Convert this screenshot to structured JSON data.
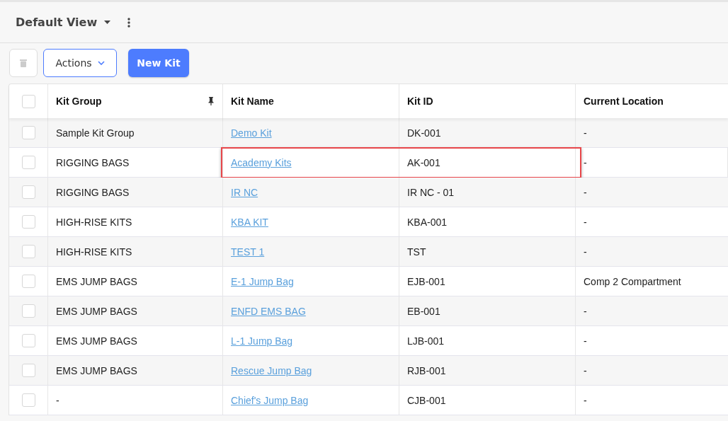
{
  "view": {
    "title": "Default View"
  },
  "toolbar": {
    "actions_label": "Actions",
    "new_label": "New Kit"
  },
  "table": {
    "all_checked": false,
    "columns": [
      {
        "label": "Kit Group",
        "pinned": true
      },
      {
        "label": "Kit Name",
        "pinned": false
      },
      {
        "label": "Kit ID",
        "pinned": false
      },
      {
        "label": "Current Location",
        "pinned": false
      }
    ],
    "rows": [
      {
        "checked": false,
        "highlighted": false,
        "group": "Sample Kit Group",
        "name": "Demo Kit",
        "id": "DK-001",
        "location": "-"
      },
      {
        "checked": false,
        "highlighted": true,
        "group": "RIGGING BAGS",
        "name": "Academy Kits",
        "id": "AK-001",
        "location": "-"
      },
      {
        "checked": false,
        "highlighted": false,
        "group": "RIGGING BAGS",
        "name": "IR NC",
        "id": "IR NC - 01",
        "location": "-"
      },
      {
        "checked": false,
        "highlighted": false,
        "group": "HIGH-RISE KITS",
        "name": "KBA KIT",
        "id": "KBA-001",
        "location": "-"
      },
      {
        "checked": false,
        "highlighted": false,
        "group": "HIGH-RISE KITS",
        "name": "TEST 1",
        "id": "TST",
        "location": "-"
      },
      {
        "checked": false,
        "highlighted": false,
        "group": "EMS JUMP BAGS",
        "name": "E-1 Jump Bag",
        "id": "EJB-001",
        "location": "Comp 2 Compartment"
      },
      {
        "checked": false,
        "highlighted": false,
        "group": "EMS JUMP BAGS",
        "name": "ENFD EMS BAG",
        "id": "EB-001",
        "location": "-"
      },
      {
        "checked": false,
        "highlighted": false,
        "group": "EMS JUMP BAGS",
        "name": "L-1 Jump Bag",
        "id": "LJB-001",
        "location": "-"
      },
      {
        "checked": false,
        "highlighted": false,
        "group": "EMS JUMP BAGS",
        "name": "Rescue Jump Bag",
        "id": "RJB-001",
        "location": "-"
      },
      {
        "checked": false,
        "highlighted": false,
        "group": "-",
        "name": "Chief's Jump Bag",
        "id": "CJB-001",
        "location": "-"
      }
    ]
  }
}
